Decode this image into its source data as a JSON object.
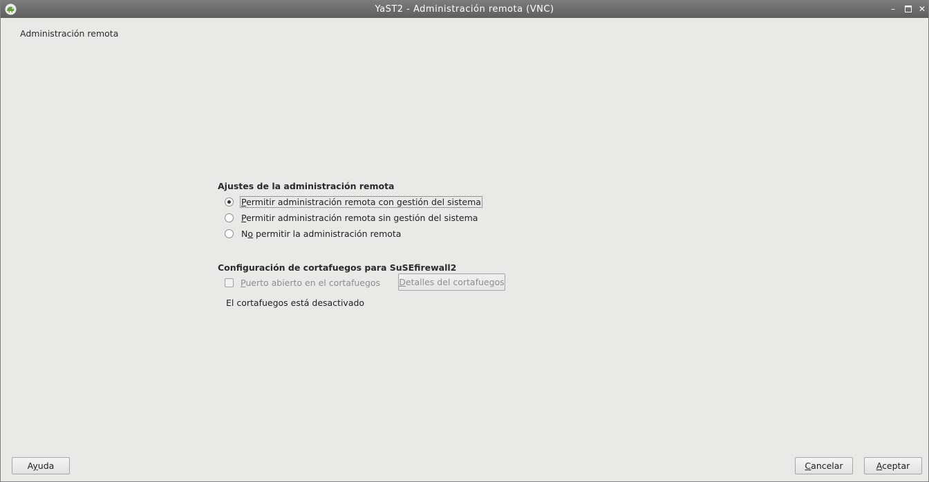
{
  "window": {
    "title": "YaST2 - Administración remota (VNC)",
    "app_icon": "yast-chameleon-icon",
    "controls": {
      "minimize": "minimize-icon",
      "maximize": "maximize-icon",
      "close": "close-icon"
    }
  },
  "dialog": {
    "title": "Administración remota"
  },
  "remote_settings": {
    "group_title": "Ajustes de la administración remota",
    "options": [
      {
        "prefix": "",
        "mnemonic": "P",
        "rest": "ermitir administración remota con gestión del sistema",
        "checked": true
      },
      {
        "prefix": "",
        "mnemonic": "P",
        "rest": "ermitir administración remota sin gestión del sistema",
        "checked": false
      },
      {
        "prefix": "N",
        "mnemonic": "o",
        "rest": " permitir la administración remota",
        "checked": false
      }
    ]
  },
  "firewall": {
    "group_title": "Configuración de cortafuegos para SuSEfirewall2",
    "open_port": {
      "mnemonic": "P",
      "rest": "uerto abierto en el cortafuegos",
      "checked": false,
      "enabled": false
    },
    "details_button": {
      "mnemonic": "D",
      "rest": "etalles del cortafuegos",
      "enabled": false
    },
    "status": "El cortafuegos está desactivado"
  },
  "footer": {
    "help": {
      "prefix": "A",
      "mnemonic": "y",
      "rest": "uda"
    },
    "cancel": {
      "mnemonic": "C",
      "rest": "ancelar"
    },
    "accept": {
      "mnemonic": "A",
      "rest": "ceptar"
    }
  },
  "colors": {
    "background": "#e9e9e6",
    "titlebar": "#6b6b6b",
    "disabled_text": "#8d8d8d"
  }
}
